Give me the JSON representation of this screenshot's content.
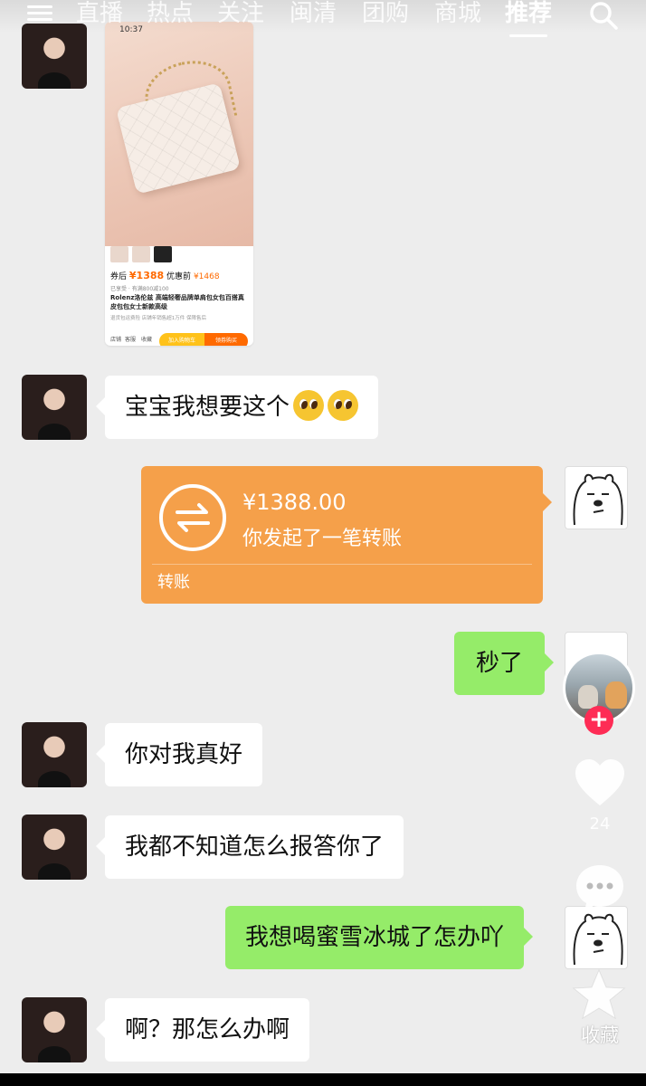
{
  "nav": {
    "tabs": [
      {
        "label": "直播"
      },
      {
        "label": "热点"
      },
      {
        "label": "关注"
      },
      {
        "label": "闽清"
      },
      {
        "label": "团购"
      },
      {
        "label": "商城"
      },
      {
        "label": "推荐"
      }
    ],
    "active_tab": "推荐",
    "menu_icon": "hamburger-menu-icon",
    "search_icon": "search-icon"
  },
  "product_card": {
    "status_time": "10:37",
    "price_label": "券后",
    "price": "¥1388",
    "compare_label": "优惠前",
    "compare_price": "¥1468",
    "subtitle": "已享受 · 有满800减100",
    "title": "Rolenz洛伦兹 高端轻奢品牌单肩包女包百搭真皮包包女士新款高级",
    "tags": "退货包运费险   店铺年销售超1万件   保障售后",
    "shop_label": "店铺",
    "service_label": "客服",
    "fav_label": "收藏",
    "cart_button": "加入购物车",
    "buy_button": "领券购买"
  },
  "messages": [
    {
      "side": "left",
      "text": "宝宝我想要这个",
      "emoji": "pleading-face-emoji x2"
    },
    {
      "side": "right",
      "type": "transfer",
      "amount": "¥1388.00",
      "desc": "你发起了一笔转账",
      "label": "转账"
    },
    {
      "side": "right",
      "text": "秒了"
    },
    {
      "side": "left",
      "text": "你对我真好"
    },
    {
      "side": "left",
      "text": "我都不知道怎么报答你了"
    },
    {
      "side": "right",
      "text": "我想喝蜜雪冰城了怎办吖"
    },
    {
      "side": "left",
      "text": "啊？那怎么办啊"
    }
  ],
  "sidebar": {
    "like_count": "24",
    "fav_label": "收藏",
    "follow_symbol": "+"
  },
  "colors": {
    "background": "#ededed",
    "bubble_self": "#95ec69",
    "bubble_other": "#ffffff",
    "transfer": "#f5a04a",
    "follow": "#fe2c55"
  }
}
